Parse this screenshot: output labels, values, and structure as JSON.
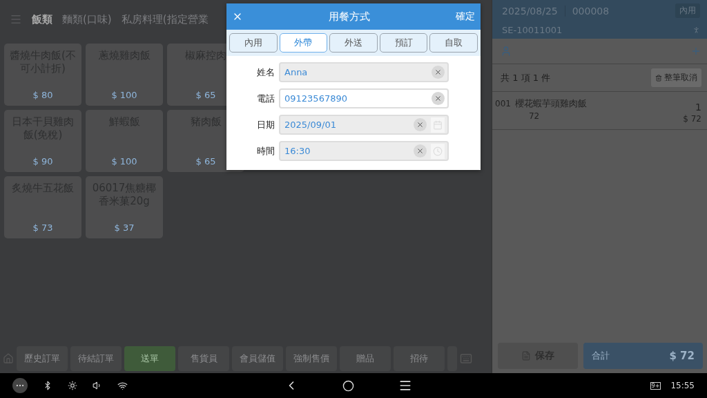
{
  "categories": [
    {
      "label": "飯類",
      "selected": true
    },
    {
      "label": "麵類(口味)",
      "selected": false
    },
    {
      "label": "私房料理(指定營業",
      "selected": false
    }
  ],
  "products": [
    {
      "name": "醬燒牛肉飯(不可小計折)",
      "price": "$ 80"
    },
    {
      "name": "蔥燒雞肉飯",
      "price": "$ 100"
    },
    {
      "name": "椒麻控肉",
      "price": "$ 65"
    },
    {
      "name": "日本干貝雞肉飯(免稅)",
      "price": "$ 90"
    },
    {
      "name": "鮮蝦飯",
      "price": "$ 100"
    },
    {
      "name": "豬肉飯",
      "price": "$ 65"
    },
    {
      "name": "炙燒牛五花飯",
      "price": "$ 73"
    },
    {
      "name": "06017焦糖椰香米菓20g",
      "price": "$ 37"
    }
  ],
  "actions": [
    {
      "label": "歷史訂單",
      "primary": false
    },
    {
      "label": "待結訂單",
      "primary": false
    },
    {
      "label": "送單",
      "primary": true
    },
    {
      "label": "售貨員",
      "primary": false
    },
    {
      "label": "會員儲值",
      "primary": false
    },
    {
      "label": "強制售價",
      "primary": false
    },
    {
      "label": "贈品",
      "primary": false
    },
    {
      "label": "招待",
      "primary": false
    }
  ],
  "order": {
    "date": "2025/08/25",
    "number": "000008",
    "mode": "內用",
    "staff": "SE-10011001",
    "summary": "共 1 項 1 件",
    "cancel_all": "整筆取消",
    "items": [
      {
        "index": "001",
        "name": "櫻花蝦芋頭雞肉飯",
        "unit_price": "72",
        "qty": "1",
        "amount": "$ 72"
      }
    ],
    "save": "保存",
    "total_label": "合計",
    "total": "$ 72"
  },
  "dialog": {
    "title": "用餐方式",
    "confirm": "確定",
    "tabs": [
      {
        "label": "內用",
        "selected": false
      },
      {
        "label": "外帶",
        "selected": true
      },
      {
        "label": "外送",
        "selected": false
      },
      {
        "label": "預訂",
        "selected": false
      },
      {
        "label": "自取",
        "selected": false
      }
    ],
    "fields": [
      {
        "label": "姓名",
        "value": "Anna",
        "kind": "text",
        "focused": false
      },
      {
        "label": "電話",
        "value": "09123567890",
        "kind": "text",
        "focused": true
      },
      {
        "label": "日期",
        "value": "2025/09/01",
        "kind": "date",
        "focused": false
      },
      {
        "label": "時間",
        "value": "16:30",
        "kind": "time",
        "focused": false
      }
    ]
  },
  "system_bar": {
    "notifications": "9+",
    "clock": "15:55"
  }
}
